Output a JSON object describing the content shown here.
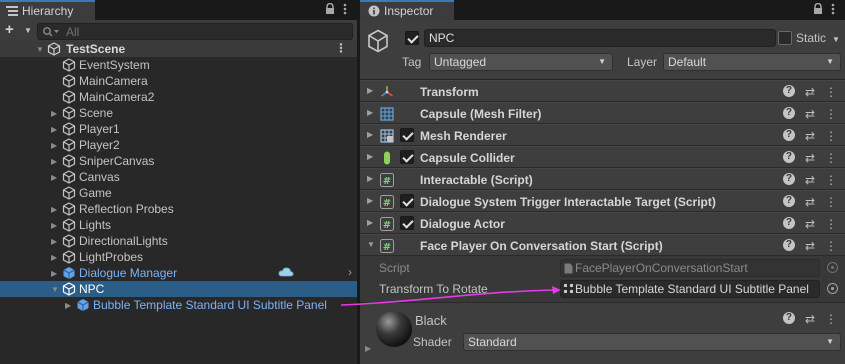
{
  "hierarchy": {
    "tab_label": "Hierarchy",
    "search_placeholder": "All",
    "create_label": "+",
    "scene_name": "TestScene",
    "items": [
      {
        "label": "EventSystem",
        "has_children": false,
        "kind": "object"
      },
      {
        "label": "MainCamera",
        "has_children": false,
        "kind": "object"
      },
      {
        "label": "MainCamera2",
        "has_children": false,
        "kind": "object"
      },
      {
        "label": "Scene",
        "has_children": true,
        "kind": "object"
      },
      {
        "label": "Player1",
        "has_children": true,
        "kind": "object"
      },
      {
        "label": "Player2",
        "has_children": true,
        "kind": "object"
      },
      {
        "label": "SniperCanvas",
        "has_children": true,
        "kind": "object"
      },
      {
        "label": "Canvas",
        "has_children": true,
        "kind": "object"
      },
      {
        "label": "Game",
        "has_children": false,
        "kind": "object"
      },
      {
        "label": "Reflection Probes",
        "has_children": true,
        "kind": "object"
      },
      {
        "label": "Lights",
        "has_children": true,
        "kind": "object"
      },
      {
        "label": "DirectionalLights",
        "has_children": true,
        "kind": "object"
      },
      {
        "label": "LightProbes",
        "has_children": true,
        "kind": "object"
      },
      {
        "label": "Dialogue Manager",
        "has_children": true,
        "kind": "prefab"
      },
      {
        "label": "NPC",
        "has_children": true,
        "expanded": true,
        "kind": "object",
        "selected": true
      },
      {
        "label": "Bubble Template Standard UI Subtitle Panel",
        "has_children": true,
        "kind": "prefab",
        "indent": 1
      }
    ]
  },
  "inspector": {
    "tab_label": "Inspector",
    "object_name": "NPC",
    "active": true,
    "static_label": "Static",
    "static_checked": false,
    "tag_label": "Tag",
    "tag_value": "Untagged",
    "layer_label": "Layer",
    "layer_value": "Default",
    "components": [
      {
        "name": "Transform",
        "icon": "transform-icon",
        "checkbox": false
      },
      {
        "name": "Capsule (Mesh Filter)",
        "icon": "mesh-filter-icon",
        "checkbox": false
      },
      {
        "name": "Mesh Renderer",
        "icon": "mesh-renderer-icon",
        "checkbox": true
      },
      {
        "name": "Capsule Collider",
        "icon": "capsule-collider-icon",
        "checkbox": true
      },
      {
        "name": "Interactable (Script)",
        "icon": "script-icon",
        "checkbox": false
      },
      {
        "name": "Dialogue System Trigger Interactable Target (Script)",
        "icon": "script-icon",
        "checkbox": true
      },
      {
        "name": "Dialogue Actor",
        "icon": "script-icon",
        "checkbox": true
      },
      {
        "name": "Face Player On Conversation Start (Script)",
        "icon": "script-icon",
        "checkbox": false,
        "expanded": true
      }
    ],
    "script_field": {
      "label": "Script",
      "value": "FacePlayerOnConversationStart"
    },
    "transform_field": {
      "label": "Transform To Rotate",
      "value": "Bubble Template Standard UI Subtitle Panel"
    },
    "material": {
      "name": "Black",
      "shader_label": "Shader",
      "shader_value": "Standard"
    }
  },
  "colors": {
    "selection": "#2c5d87",
    "prefab_text": "#7fb2f4",
    "annotation_arrow": "#e03ee0"
  }
}
